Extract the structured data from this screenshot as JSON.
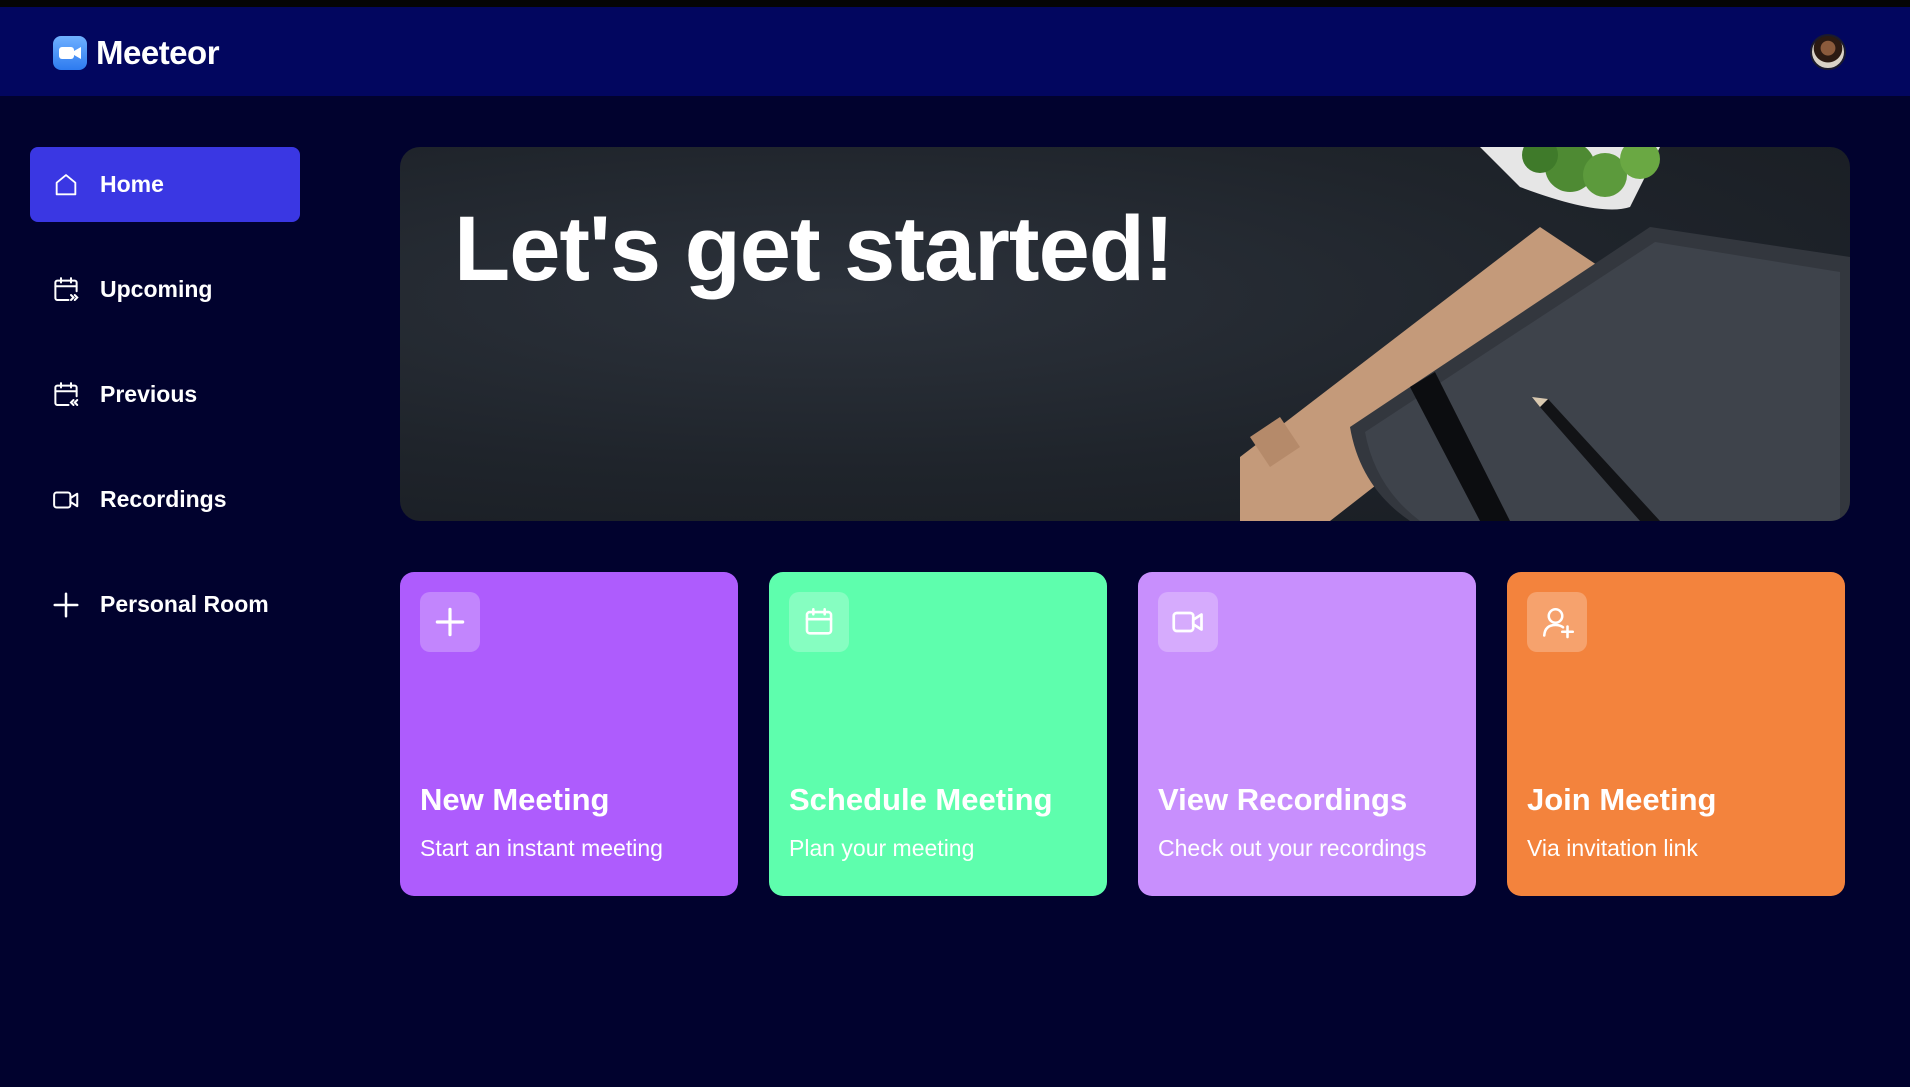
{
  "app": {
    "name": "Meeteor"
  },
  "sidebar": {
    "items": [
      {
        "label": "Home",
        "icon": "home-icon",
        "active": true
      },
      {
        "label": "Upcoming",
        "icon": "calendar-upcoming-icon"
      },
      {
        "label": "Previous",
        "icon": "calendar-previous-icon"
      },
      {
        "label": "Recordings",
        "icon": "video-icon"
      },
      {
        "label": "Personal Room",
        "icon": "plus-icon"
      }
    ]
  },
  "hero": {
    "title": "Let's get started!"
  },
  "cards": [
    {
      "title": "New Meeting",
      "subtitle": "Start an instant meeting",
      "icon": "plus-icon",
      "color": "#ae5cfd"
    },
    {
      "title": "Schedule Meeting",
      "subtitle": "Plan your meeting",
      "icon": "calendar-icon",
      "color": "#5efead"
    },
    {
      "title": "View Recordings",
      "subtitle": "Check out your recordings",
      "icon": "video-icon",
      "color": "#c88ffd"
    },
    {
      "title": "Join Meeting",
      "subtitle": "Via invitation link",
      "icon": "add-user-icon",
      "color": "#f3833d"
    }
  ],
  "colors": {
    "background": "#01022e",
    "navbar": "#02065f",
    "accent": "#3a37e3"
  }
}
